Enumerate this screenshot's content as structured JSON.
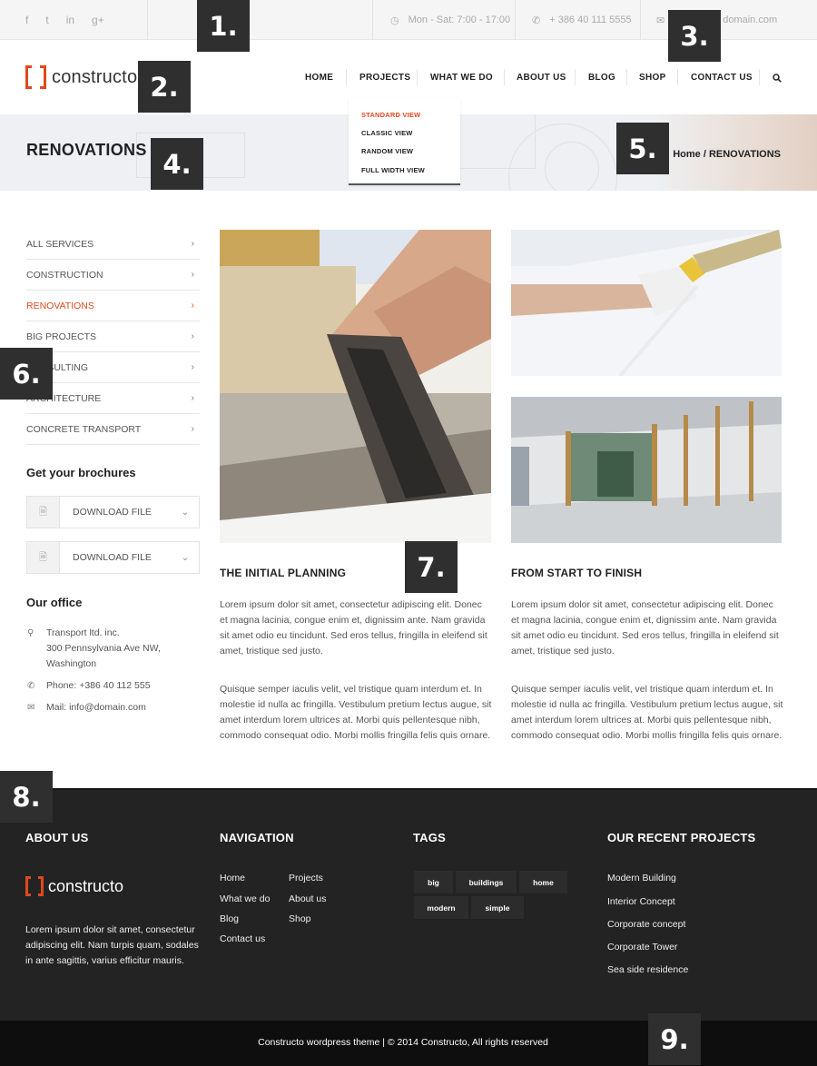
{
  "topbar": {
    "social_icons": [
      "facebook-icon",
      "twitter-icon",
      "linkedin-icon",
      "google-plus-icon"
    ],
    "social_glyphs": [
      "f",
      "t",
      "in",
      "g+"
    ],
    "hours": "Mon - Sat: 7:00 - 17:00",
    "phone": "+ 386 40 111 5555",
    "email_fragment": "domain.com"
  },
  "header": {
    "logo_text": "constructo",
    "nav": [
      "HOME",
      "PROJECTS",
      "WHAT WE DO",
      "ABOUT US",
      "BLOG",
      "SHOP",
      "CONTACT US"
    ],
    "search_icon": "search-icon"
  },
  "dropdown": {
    "items": [
      "STANDARD VIEW",
      "CLASSIC VIEW",
      "RANDOM VIEW",
      "FULL WIDTH VIEW"
    ],
    "active_index": 0
  },
  "page": {
    "title": "RENOVATIONS",
    "breadcrumb_home": "Home",
    "breadcrumb_sep": "/",
    "breadcrumb_current": "RENOVATIONS"
  },
  "sidebar": {
    "items": [
      {
        "label": "ALL SERVICES",
        "active": false
      },
      {
        "label": "CONSTRUCTION",
        "active": false
      },
      {
        "label": "RENOVATIONS",
        "active": true
      },
      {
        "label": "BIG PROJECTS",
        "active": false
      },
      {
        "label": "CONSULTING",
        "active": false
      },
      {
        "label": "ARCHITECTURE",
        "active": false
      },
      {
        "label": "CONCRETE TRANSPORT",
        "active": false
      }
    ],
    "brochures_heading": "Get your brochures",
    "downloads": [
      {
        "label": "DOWNLOAD FILE",
        "icon": "pdf-file-icon"
      },
      {
        "label": "DOWNLOAD FILE",
        "icon": "doc-file-icon"
      }
    ],
    "office_heading": "Our office",
    "office_address": [
      "Transport ltd. inc.",
      "300 Pennsylvania Ave NW,",
      "Washington"
    ],
    "office_phone": "Phone: +386 40 112 555",
    "office_mail": "Mail: info@domain.com"
  },
  "articles": [
    {
      "title": "THE INITIAL PLANNING",
      "p1": "Lorem ipsum dolor sit amet, consectetur adipiscing elit. Donec et magna lacinia, congue enim et, dignissim ante. Nam gravida sit amet odio eu tincidunt. Sed eros tellus, fringilla in eleifend sit amet, tristique sed justo.",
      "p2": "Quisque semper iaculis velit, vel tristique quam interdum et. In molestie id nulla ac fringilla. Vestibulum pretium lectus augue, sit amet interdum lorem ultrices at. Morbi quis pellentesque nibh, commodo consequat odio. Morbi mollis fringilla felis quis ornare."
    },
    {
      "title": "FROM START TO FINISH",
      "p1": "Lorem ipsum dolor sit amet, consectetur adipiscing elit. Donec et magna lacinia, congue enim et, dignissim ante. Nam gravida sit amet odio eu tincidunt. Sed eros tellus, fringilla in eleifend sit amet, tristique sed justo.",
      "p2": "Quisque semper iaculis velit, vel tristique quam interdum et. In molestie id nulla ac fringilla. Vestibulum pretium lectus augue, sit amet interdum lorem ultrices at. Morbi quis pellentesque nibh, commodo consequat odio. Morbi mollis fringilla felis quis ornare."
    }
  ],
  "footer": {
    "about_heading": "ABOUT US",
    "logo_text": "constructo",
    "about_text": "Lorem ipsum dolor sit amet, consectetur adipiscing elit. Nam turpis quam, sodales in ante sagittis, varius efficitur mauris.",
    "nav_heading": "NAVIGATION",
    "nav_col1": [
      "Home",
      "What we do",
      "Blog",
      "Contact us"
    ],
    "nav_col2": [
      "Projects",
      "About us",
      "Shop"
    ],
    "tags_heading": "TAGS",
    "tags": [
      "big",
      "buildings",
      "home",
      "modern",
      "simple"
    ],
    "projects_heading": "OUR RECENT PROJECTS",
    "projects": [
      "Modern Building",
      "Interior Concept",
      "Corporate concept",
      "Corporate Tower",
      "Sea side residence"
    ],
    "copyright": "Constructo wordpress theme | © 2014 Constructo, All rights reserved"
  },
  "badges": [
    "1.",
    "2.",
    "3.",
    "4.",
    "5.",
    "6.",
    "7.",
    "8.",
    "9."
  ],
  "colors": {
    "accent": "#e0491c",
    "footer_bg": "#232323",
    "bottombar_bg": "#0e0e0e",
    "badge_bg": "#2f2f2f"
  }
}
